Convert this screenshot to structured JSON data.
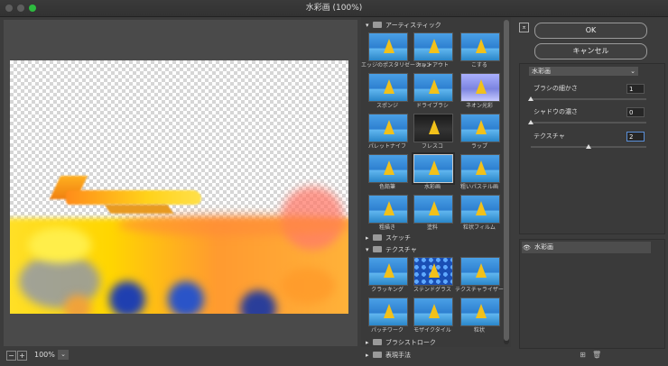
{
  "window": {
    "title": "水彩画 (100%)"
  },
  "preview": {
    "zoom": "100%",
    "zoom_out": "−",
    "zoom_in": "+",
    "zoom_menu": "⌄"
  },
  "gallery": {
    "categories": [
      {
        "name": "アーティスティック",
        "expanded": true,
        "filters": [
          "エッジのポスタリゼーション",
          "カットアウト",
          "こする",
          "スポンジ",
          "ドライブラシ",
          "ネオン光彩",
          "パレットナイフ",
          "フレスコ",
          "ラップ",
          "色鉛筆",
          "水彩画",
          "粗いパステル画",
          "粗描き",
          "塗料",
          "粒状フィルム"
        ]
      },
      {
        "name": "スケッチ",
        "expanded": false
      },
      {
        "name": "テクスチャ",
        "expanded": true,
        "filters": [
          "クラッキング",
          "ステンドグラス",
          "テクスチャライザー",
          "パッチワーク",
          "モザイクタイル",
          "粒状"
        ]
      },
      {
        "name": "ブラシストローク",
        "expanded": false
      },
      {
        "name": "表現手法",
        "expanded": false
      }
    ],
    "selected_filter": "水彩画"
  },
  "actions": {
    "collapse": "⌅",
    "ok": "OK",
    "cancel": "キャンセル"
  },
  "settings": {
    "filter_select": "水彩画",
    "params": [
      {
        "label": "ブラシの細かさ",
        "value": "1",
        "level": 0.0
      },
      {
        "label": "シャドウの濃さ",
        "value": "0",
        "level": 0.0
      },
      {
        "label": "テクスチャ",
        "value": "2",
        "level": 0.5
      }
    ]
  },
  "layers": {
    "items": [
      {
        "name": "水彩画",
        "visible_icon": "eye-icon"
      }
    ],
    "new_layer": "⊞",
    "delete_layer": "🗑"
  },
  "colors": {
    "accent_focus": "#5a8fd8",
    "background": "#3c3c3c"
  }
}
